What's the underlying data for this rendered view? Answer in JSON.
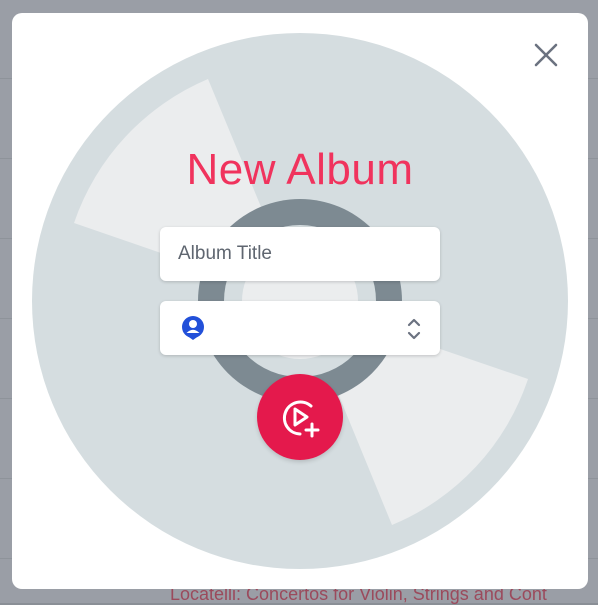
{
  "modal": {
    "title": "New Album",
    "close_icon": "close-icon"
  },
  "form": {
    "album_title": {
      "placeholder": "Album Title",
      "value": ""
    },
    "artist_select": {
      "value": "",
      "leading_icon": "user-icon",
      "trailing_icon": "chevrons-up-down-icon"
    },
    "create_button_icon": "play-circle-plus-icon"
  },
  "background": {
    "visible_text": "Locatelli: Concertos for Violin, Strings and Cont"
  },
  "colors": {
    "title": "#f0335d",
    "accent": "#e4194c",
    "record_fill": "#d5dde0",
    "record_ring": "#7d8a92",
    "user_icon": "#2250d9"
  }
}
